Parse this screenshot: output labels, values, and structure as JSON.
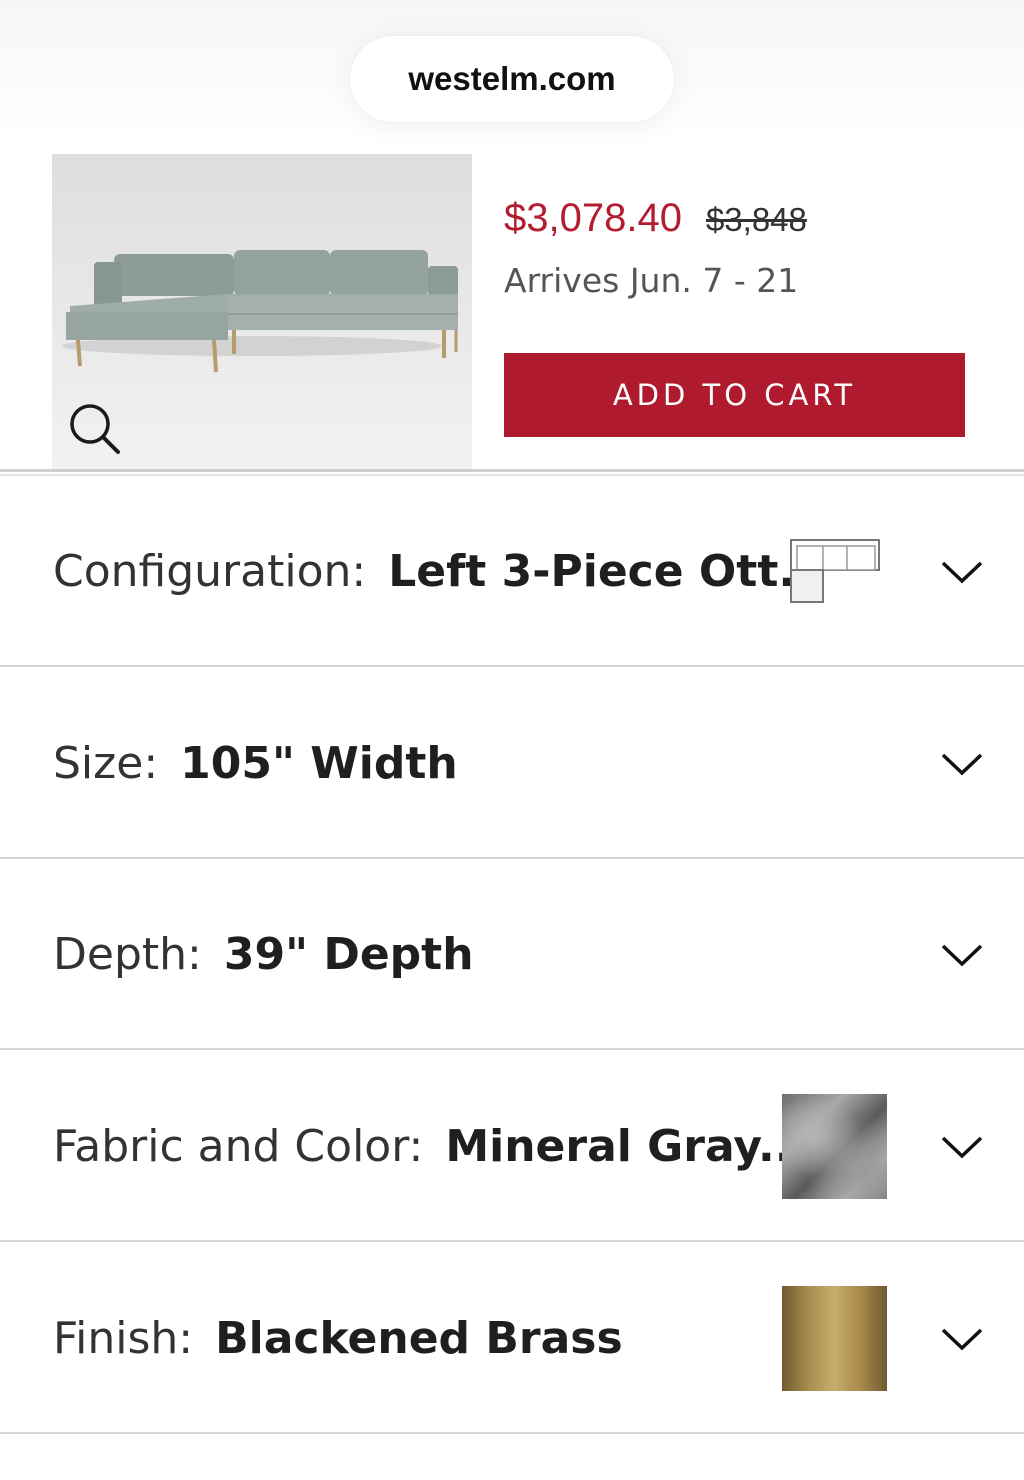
{
  "browser": {
    "url": "westelm.com"
  },
  "product": {
    "sale_price": "$3,078.40",
    "original_price": "$3,848",
    "arrives": "Arrives Jun. 7 - 21",
    "add_to_cart_label": "ADD TO CART"
  },
  "colors": {
    "accent": "#b01a2f",
    "sale_text": "#b41c30"
  },
  "options": [
    {
      "label": "Configuration:",
      "value": "Left 3-Piece Ott...",
      "icon": "configuration-diagram-icon"
    },
    {
      "label": "Size:",
      "value": "105\" Width"
    },
    {
      "label": "Depth:",
      "value": "39\" Depth"
    },
    {
      "label": "Fabric and Color:",
      "value": "Mineral Gray...",
      "swatch": "fabric-swatch"
    },
    {
      "label": "Finish:",
      "value": "Blackened Brass",
      "swatch": "finish-swatch"
    }
  ]
}
